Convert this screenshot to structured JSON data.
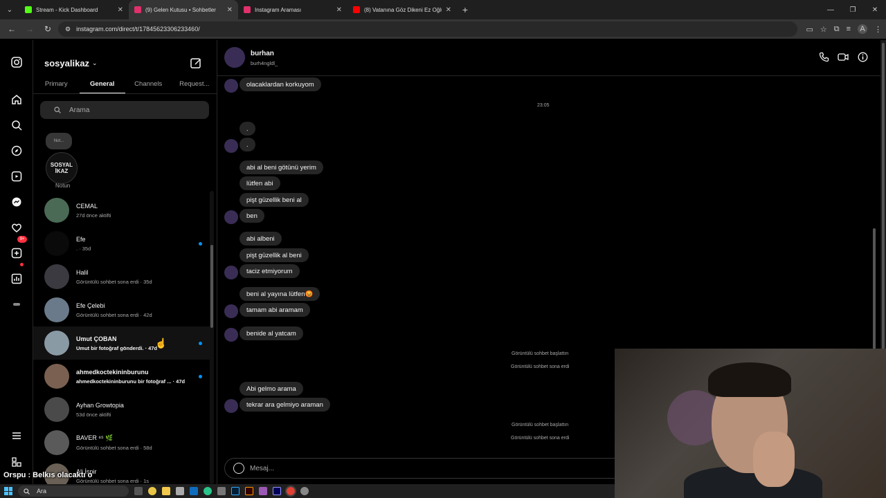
{
  "browser": {
    "tabs": [
      {
        "label": "Stream - Kick Dashboard",
        "color": "#53fc18"
      },
      {
        "label": "(9) Gelen Kutusu • Sohbetler",
        "color": "#e1306c"
      },
      {
        "label": "Instagram Araması",
        "color": "#e1306c"
      },
      {
        "label": "(8) Vatanına Göz Dikeni Ez Oğlu",
        "color": "#ff0000"
      }
    ],
    "url": "instagram.com/direct/t/17845623306233460/",
    "profile_initial": "A"
  },
  "rail": {
    "badge": "9+"
  },
  "inbox": {
    "account": "sosyalikaz",
    "tabs": [
      "Primary",
      "General",
      "Channels",
      "Request..."
    ],
    "active_tab": "General",
    "search_placeholder": "Arama",
    "note_bubble": "Not...",
    "note_avatar_line1": "SOSYAL",
    "note_avatar_line2": "İKAZ",
    "note_label": "Notun",
    "conversations": [
      {
        "name": "CEMAL",
        "sub": "27d önce aktifti",
        "unread": false,
        "bold": false,
        "color": "#4a6a55"
      },
      {
        "name": "Efe",
        "sub": ". · 35d",
        "unread": true,
        "bold": false,
        "color": "#0a0a0a"
      },
      {
        "name": "Halil",
        "sub": "Görüntülü sohbet sona erdi · 35d",
        "unread": false,
        "bold": false,
        "color": "#3a3a40"
      },
      {
        "name": "Efe Çelebi",
        "sub": "Görüntülü sohbet sona erdi · 42d",
        "unread": false,
        "bold": false,
        "color": "#6a7a8a"
      },
      {
        "name": "Umut ÇOBAN",
        "sub": "Umut bir fotoğraf gönderdi. · 47d",
        "unread": true,
        "bold": true,
        "color": "#8a9aa5"
      },
      {
        "name": "ahmedkoctekininburunu",
        "sub": "ahmedkoctekininburunu bir fotoğraf ... · 47d",
        "unread": true,
        "bold": true,
        "color": "#7a6050"
      },
      {
        "name": "Ayhan Growtopia",
        "sub": "53d önce aktifti",
        "unread": false,
        "bold": false,
        "color": "#4a4a4a"
      },
      {
        "name": "BAVER ⁶⁵ 🌿",
        "sub": "Görüntülü sohbet sona erdi · 58d",
        "unread": false,
        "bold": false,
        "color": "#5a5a5a"
      },
      {
        "name": "Ali İspir",
        "sub": "Görüntülü sohbet sona erdi · 1s",
        "unread": false,
        "bold": false,
        "color": "#6a6055"
      }
    ]
  },
  "chat": {
    "name": "burhan",
    "username": "burh4ngldl_",
    "messages": [
      {
        "text": "olacaklardan korkuyom"
      },
      {
        "text": "."
      },
      {
        "text": "."
      },
      {
        "text": "abi al beni götünü yerim"
      },
      {
        "text": "lütfen abi"
      },
      {
        "text": "pişt güzellik beni al"
      },
      {
        "text": "ben"
      },
      {
        "text": "abi albeni"
      },
      {
        "text": "pişt güzellik al beni"
      },
      {
        "text": "taciz etmiyorum"
      },
      {
        "text": "beni al yayına lütfen😡"
      },
      {
        "text": "tamam abi aramam"
      },
      {
        "text": "benide al yatcam"
      },
      {
        "text": "Abi gelmo arama"
      },
      {
        "text": "tekrar ara gelmiyo araman"
      }
    ],
    "timestamp": "23:05",
    "system": [
      "Görüntülü sohbet başlattın",
      "Görüntülü sohbet sona erdi",
      "Görüntülü sohbet başlattın",
      "Görüntülü sohbet sona erdi"
    ],
    "input_placeholder": "Mesaj..."
  },
  "overlay": {
    "caption": "Orspu : Belkıs olacaktı o"
  },
  "taskbar": {
    "search": "Ara"
  }
}
